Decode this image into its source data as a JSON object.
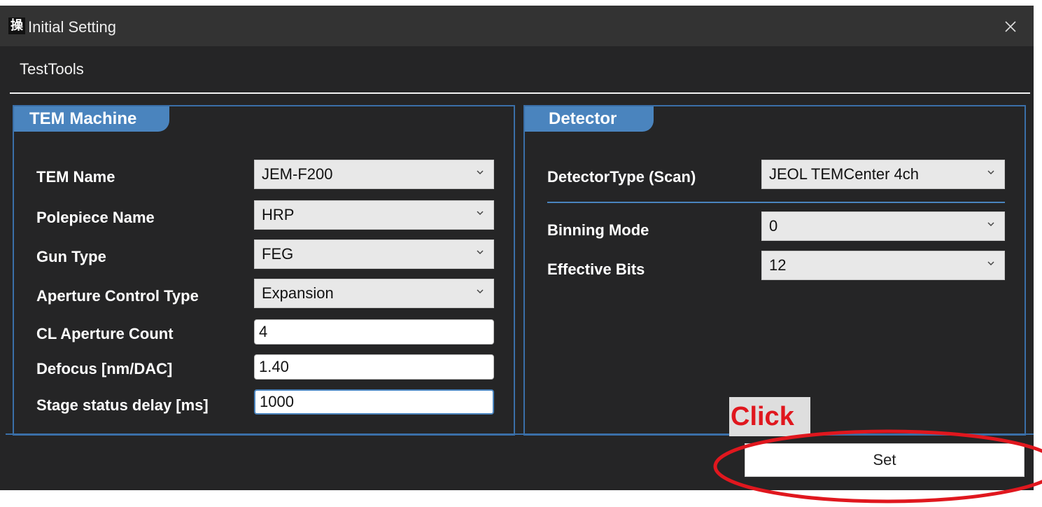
{
  "window": {
    "title": "Initial Setting",
    "icon_glyph": "操",
    "icon": "app-icon",
    "close_icon": "close-icon"
  },
  "menu": {
    "items": [
      "TestTools"
    ]
  },
  "tem_machine": {
    "header": "TEM Machine",
    "fields": [
      {
        "label": "TEM Name",
        "kind": "combo",
        "value": "JEM-F200"
      },
      {
        "label": "Polepiece Name",
        "kind": "combo",
        "value": "HRP"
      },
      {
        "label": "Gun Type",
        "kind": "combo",
        "value": "FEG"
      },
      {
        "label": "Aperture Control Type",
        "kind": "combo",
        "value": "Expansion"
      },
      {
        "label": "CL Aperture Count",
        "kind": "text",
        "value": "4"
      },
      {
        "label": "Defocus [nm/DAC]",
        "kind": "text",
        "value": "1.40"
      },
      {
        "label": "Stage status delay [ms]",
        "kind": "text",
        "value": "1000"
      }
    ]
  },
  "detector": {
    "header": "Detector",
    "fields": [
      {
        "label": "DetectorType (Scan)",
        "kind": "combo",
        "value": "JEOL TEMCenter 4ch"
      },
      {
        "label": "Binning Mode",
        "kind": "combo",
        "value": "0"
      },
      {
        "label": "Effective Bits",
        "kind": "combo",
        "value": "12"
      }
    ]
  },
  "footer": {
    "set_label": "Set"
  },
  "annotation": {
    "text": "Click",
    "color": "#e0171e"
  },
  "colors": {
    "accent": "#4a84be",
    "window_bg": "#252526",
    "titlebar_bg": "#333333"
  }
}
